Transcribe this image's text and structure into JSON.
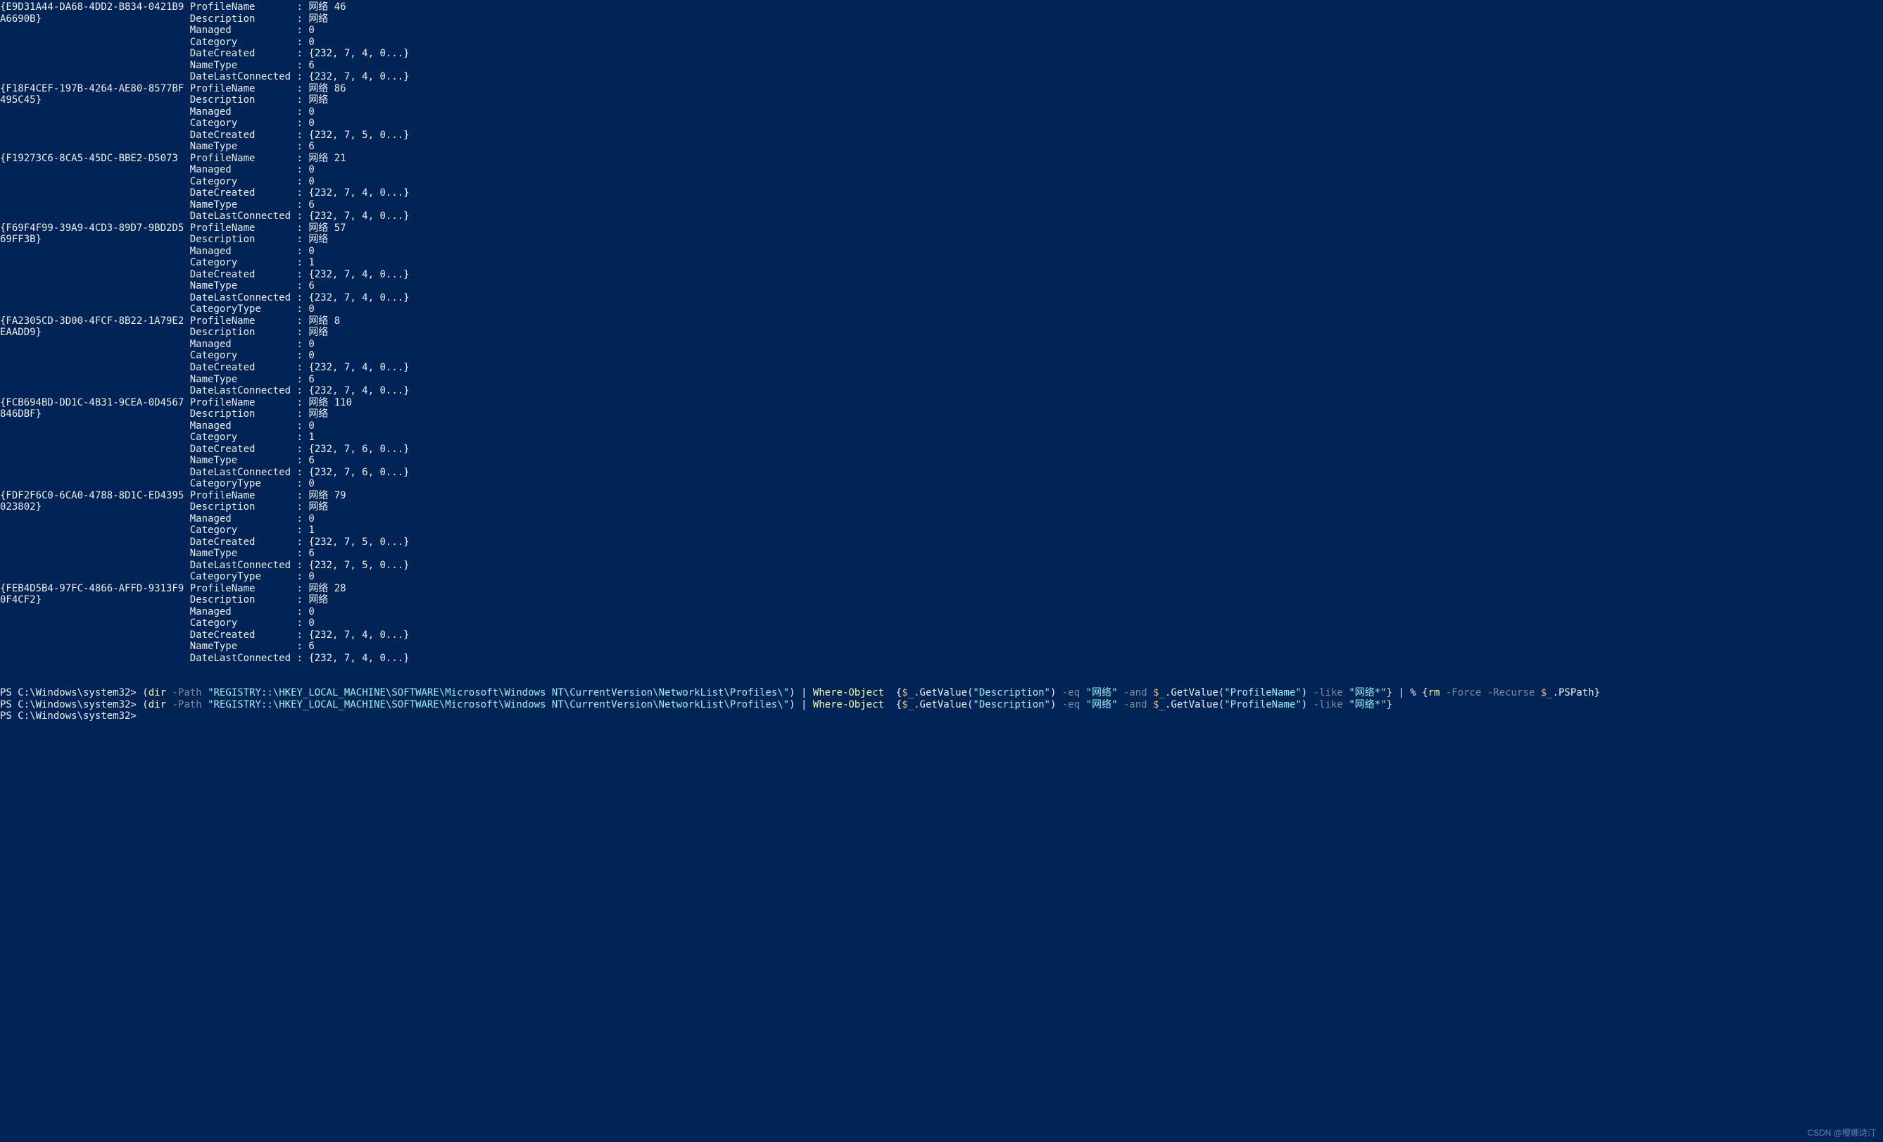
{
  "colors": {
    "background": "#012456",
    "fg": "#eeedf0",
    "cyan": "#8ff4ee",
    "gray": "#7e8d8d",
    "yellow": "#f9f7a1",
    "green": "#7ef492",
    "orange": "#f4b56f"
  },
  "property_col_width": 17,
  "entries": [
    {
      "key": "{E9D31A44-DA68-4DD2-B834-0421B9A6690B}",
      "props": [
        [
          "ProfileName",
          "网络 46"
        ],
        [
          "Description",
          "网络"
        ],
        [
          "Managed",
          "0"
        ],
        [
          "Category",
          "0"
        ],
        [
          "DateCreated",
          "{232, 7, 4, 0...}"
        ],
        [
          "NameType",
          "6"
        ],
        [
          "DateLastConnected",
          "{232, 7, 4, 0...}"
        ]
      ]
    },
    {
      "key": "{F18F4CEF-197B-4264-AE80-8577BF495C45}",
      "props": [
        [
          "ProfileName",
          "网络 86"
        ],
        [
          "Description",
          "网络"
        ],
        [
          "Managed",
          "0"
        ],
        [
          "Category",
          "0"
        ],
        [
          "DateCreated",
          "{232, 7, 5, 0...}"
        ],
        [
          "NameType",
          "6"
        ]
      ]
    },
    {
      "key": "{F19273C6-8CA5-45DC-BBE2-D5073",
      "continuation_only": true,
      "props": [
        [
          "ProfileName",
          "网络 21"
        ],
        [
          "Managed",
          "0"
        ],
        [
          "Category",
          "0"
        ],
        [
          "DateCreated",
          "{232, 7, 4, 0...}"
        ],
        [
          "NameType",
          "6"
        ],
        [
          "DateLastConnected",
          "{232, 7, 4, 0...}"
        ]
      ]
    },
    {
      "key": "{F69F4F99-39A9-4CD3-89D7-9BD2D569FF3B}",
      "props": [
        [
          "ProfileName",
          "网络 57"
        ],
        [
          "Description",
          "网络"
        ],
        [
          "Managed",
          "0"
        ],
        [
          "Category",
          "1"
        ],
        [
          "DateCreated",
          "{232, 7, 4, 0...}"
        ],
        [
          "NameType",
          "6"
        ],
        [
          "DateLastConnected",
          "{232, 7, 4, 0...}"
        ],
        [
          "CategoryType",
          "0"
        ]
      ]
    },
    {
      "key": "{FA2305CD-3D00-4FCF-8B22-1A79E2EAADD9}",
      "props": [
        [
          "ProfileName",
          "网络 8"
        ],
        [
          "Description",
          "网络"
        ],
        [
          "Managed",
          "0"
        ],
        [
          "Category",
          "0"
        ],
        [
          "DateCreated",
          "{232, 7, 4, 0...}"
        ],
        [
          "NameType",
          "6"
        ],
        [
          "DateLastConnected",
          "{232, 7, 4, 0...}"
        ]
      ]
    },
    {
      "key": "{FCB694BD-DD1C-4B31-9CEA-0D4567846DBF}",
      "props": [
        [
          "ProfileName",
          "网络 110"
        ],
        [
          "Description",
          "网络"
        ],
        [
          "Managed",
          "0"
        ],
        [
          "Category",
          "1"
        ],
        [
          "DateCreated",
          "{232, 7, 6, 0...}"
        ],
        [
          "NameType",
          "6"
        ],
        [
          "DateLastConnected",
          "{232, 7, 6, 0...}"
        ],
        [
          "CategoryType",
          "0"
        ]
      ]
    },
    {
      "key": "{FDF2F6C0-6CA0-4788-8D1C-ED4395023802}",
      "props": [
        [
          "ProfileName",
          "网络 79"
        ],
        [
          "Description",
          "网络"
        ],
        [
          "Managed",
          "0"
        ],
        [
          "Category",
          "1"
        ],
        [
          "DateCreated",
          "{232, 7, 5, 0...}"
        ],
        [
          "NameType",
          "6"
        ],
        [
          "DateLastConnected",
          "{232, 7, 5, 0...}"
        ],
        [
          "CategoryType",
          "0"
        ]
      ]
    },
    {
      "key": "{FEB4D5B4-97FC-4866-AFFD-9313F90F4CF2}",
      "props": [
        [
          "ProfileName",
          "网络 28"
        ],
        [
          "Description",
          "网络"
        ],
        [
          "Managed",
          "0"
        ],
        [
          "Category",
          "0"
        ],
        [
          "DateCreated",
          "{232, 7, 4, 0...}"
        ],
        [
          "NameType",
          "6"
        ],
        [
          "DateLastConnected",
          "{232, 7, 4, 0...}"
        ]
      ]
    }
  ],
  "blank_line_after_entries": true,
  "prompts": [
    {
      "prefix": "PS C:\\Windows\\system32> ",
      "segments": [
        {
          "t": "(",
          "c": "w"
        },
        {
          "t": "dir",
          "c": "yl"
        },
        {
          "t": " ",
          "c": "w"
        },
        {
          "t": "-Path",
          "c": "gy"
        },
        {
          "t": " ",
          "c": "w"
        },
        {
          "t": "\"REGISTRY::\\HKEY_LOCAL_MACHINE\\SOFTWARE\\Microsoft\\Windows NT\\CurrentVersion\\NetworkList\\Profiles\\\"",
          "c": "cy"
        },
        {
          "t": ") ",
          "c": "w"
        },
        {
          "t": "| ",
          "c": "w"
        },
        {
          "t": "Where-Object",
          "c": "yl"
        },
        {
          "t": "  {",
          "c": "w"
        },
        {
          "t": "$_",
          "c": "or"
        },
        {
          "t": ".GetValue(",
          "c": "w"
        },
        {
          "t": "\"Description\"",
          "c": "cy"
        },
        {
          "t": ") ",
          "c": "w"
        },
        {
          "t": "-eq",
          "c": "gy"
        },
        {
          "t": " ",
          "c": "w"
        },
        {
          "t": "\"网络\"",
          "c": "cy"
        },
        {
          "t": " ",
          "c": "w"
        },
        {
          "t": "-and",
          "c": "gy"
        },
        {
          "t": " ",
          "c": "w"
        },
        {
          "t": "$_",
          "c": "or"
        },
        {
          "t": ".GetValue(",
          "c": "w"
        },
        {
          "t": "\"ProfileName\"",
          "c": "cy"
        },
        {
          "t": ") ",
          "c": "w"
        },
        {
          "t": "-like",
          "c": "gy"
        },
        {
          "t": " ",
          "c": "w"
        },
        {
          "t": "\"网络*\"",
          "c": "cy"
        },
        {
          "t": "} ",
          "c": "w"
        },
        {
          "t": "| % ",
          "c": "w"
        },
        {
          "t": "{",
          "c": "w"
        },
        {
          "t": "rm",
          "c": "yl"
        },
        {
          "t": " ",
          "c": "w"
        },
        {
          "t": "-Force -Recurse",
          "c": "gy"
        },
        {
          "t": " ",
          "c": "w"
        },
        {
          "t": "$_",
          "c": "or"
        },
        {
          "t": ".PSPath}",
          "c": "w"
        }
      ]
    },
    {
      "prefix": "PS C:\\Windows\\system32> ",
      "segments": [
        {
          "t": "(",
          "c": "w"
        },
        {
          "t": "dir",
          "c": "yl"
        },
        {
          "t": " ",
          "c": "w"
        },
        {
          "t": "-Path",
          "c": "gy"
        },
        {
          "t": " ",
          "c": "w"
        },
        {
          "t": "\"REGISTRY::\\HKEY_LOCAL_MACHINE\\SOFTWARE\\Microsoft\\Windows NT\\CurrentVersion\\NetworkList\\Profiles\\\"",
          "c": "cy"
        },
        {
          "t": ") ",
          "c": "w"
        },
        {
          "t": "| ",
          "c": "w"
        },
        {
          "t": "Where-Object",
          "c": "yl"
        },
        {
          "t": "  {",
          "c": "w"
        },
        {
          "t": "$_",
          "c": "or"
        },
        {
          "t": ".GetValue(",
          "c": "w"
        },
        {
          "t": "\"Description\"",
          "c": "cy"
        },
        {
          "t": ") ",
          "c": "w"
        },
        {
          "t": "-eq",
          "c": "gy"
        },
        {
          "t": " ",
          "c": "w"
        },
        {
          "t": "\"网络\"",
          "c": "cy"
        },
        {
          "t": " ",
          "c": "w"
        },
        {
          "t": "-and",
          "c": "gy"
        },
        {
          "t": " ",
          "c": "w"
        },
        {
          "t": "$_",
          "c": "or"
        },
        {
          "t": ".GetValue(",
          "c": "w"
        },
        {
          "t": "\"ProfileName\"",
          "c": "cy"
        },
        {
          "t": ") ",
          "c": "w"
        },
        {
          "t": "-like",
          "c": "gy"
        },
        {
          "t": " ",
          "c": "w"
        },
        {
          "t": "\"网络*\"",
          "c": "cy"
        },
        {
          "t": "}",
          "c": "w"
        }
      ]
    },
    {
      "prefix": "PS C:\\Windows\\system32> ",
      "segments": []
    }
  ],
  "watermark": "CSDN @樱娜诗汀"
}
